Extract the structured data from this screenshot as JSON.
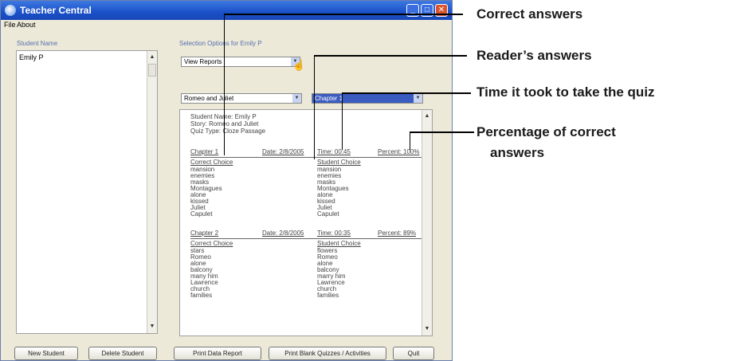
{
  "window": {
    "title": "Teacher Central",
    "menu": [
      "File",
      "About"
    ]
  },
  "left_panel": {
    "label": "Student Name",
    "students": [
      "Emily P"
    ]
  },
  "right_panel": {
    "label": "Selection Options for Emily P",
    "report_type": "View Reports",
    "story": "Romeo and Juliet",
    "quiz": "Chapter 1"
  },
  "report": {
    "student_line": "Student Name: Emily P",
    "story_line": "Story: Romeo and Juliet",
    "quiz_type_line": "Quiz Type: Cloze Passage",
    "correct_header": "Correct Choice",
    "student_header": "Student Choice",
    "sections": [
      {
        "chapter": "Chapter 1",
        "date": "Date: 2/8/2005",
        "time": "Time: 00:45",
        "percent": "Percent: 100%",
        "correct": [
          "mansion",
          "enemies",
          "masks",
          "Montagues",
          "alone",
          "kissed",
          "Juliet",
          "Capulet"
        ],
        "student": [
          "mansion",
          "enemies",
          "masks",
          "Montagues",
          "alone",
          "kissed",
          "Juliet",
          "Capulet"
        ]
      },
      {
        "chapter": "Chapter 2",
        "date": "Date: 2/8/2005",
        "time": "Time: 00:35",
        "percent": "Percent: 89%",
        "correct": [
          "stars",
          "Romeo",
          "alone",
          "balcony",
          "many him",
          "Lawrence",
          "church",
          "families"
        ],
        "student": [
          "flowers",
          "Romeo",
          "alone",
          "balcony",
          "marry him",
          "Lawrence",
          "church",
          "families"
        ]
      }
    ]
  },
  "buttons": {
    "new_student": "New Student",
    "delete_student": "Delete Student",
    "print_data_report": "Print Data Report",
    "print_blank": "Print Blank Quizzes / Activities",
    "quit": "Quit"
  },
  "callouts": {
    "correct_answers": "Correct answers",
    "readers_answers": "Reader’s answers",
    "time": "Time it took to take the quiz",
    "percentage_1": "Percentage of correct",
    "percentage_2": "answers"
  }
}
